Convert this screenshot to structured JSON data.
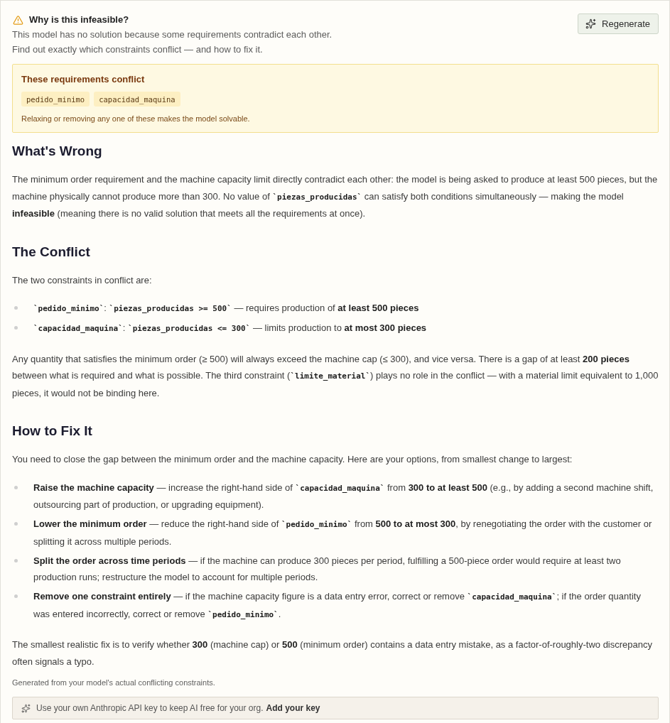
{
  "header": {
    "title": "Why is this infeasible?",
    "description": [
      "This model has no solution because some requirements contradict each other.",
      "Find out exactly which constraints conflict — and how to fix it."
    ],
    "regenerate_button": "Regenerate"
  },
  "conflict_box": {
    "title": "These requirements conflict",
    "constraints": [
      "pedido_minimo",
      "capacidad_maquina"
    ],
    "note": "Relaxing or removing any one of these makes the model solvable."
  },
  "sections": [
    {
      "heading": "What's Wrong",
      "blocks": [
        {
          "kind": "paragraph",
          "segments": [
            {
              "kind": "text",
              "text": "The minimum order requirement and the machine capacity limit directly contradict each other: the model is being asked to produce at least 500 pieces, but the machine physically cannot produce more than 300. No value of "
            },
            {
              "kind": "code",
              "text": "`piezas_producidas`"
            },
            {
              "kind": "text",
              "text": " can satisfy both conditions simultaneously — making the model "
            },
            {
              "kind": "bold",
              "text": "infeasible"
            },
            {
              "kind": "text",
              "text": " (meaning there is no valid solution that meets all the requirements at once)."
            }
          ]
        }
      ]
    },
    {
      "heading": "The Conflict",
      "blocks": [
        {
          "kind": "paragraph",
          "segments": [
            {
              "kind": "text",
              "text": "The two constraints in conflict are:"
            }
          ]
        },
        {
          "kind": "list",
          "items": [
            {
              "segments": [
                {
                  "kind": "code",
                  "text": "`pedido_minimo`"
                },
                {
                  "kind": "text",
                  "text": ": "
                },
                {
                  "kind": "code",
                  "text": "`piezas_producidas >= 500`"
                },
                {
                  "kind": "text",
                  "text": " — requires production of "
                },
                {
                  "kind": "bold",
                  "text": "at least 500 pieces"
                }
              ]
            },
            {
              "segments": [
                {
                  "kind": "code",
                  "text": "`capacidad_maquina`"
                },
                {
                  "kind": "text",
                  "text": ": "
                },
                {
                  "kind": "code",
                  "text": "`piezas_producidas <= 300`"
                },
                {
                  "kind": "text",
                  "text": " — limits production to "
                },
                {
                  "kind": "bold",
                  "text": "at most 300 pieces"
                }
              ]
            }
          ]
        },
        {
          "kind": "paragraph",
          "segments": [
            {
              "kind": "text",
              "text": "Any quantity that satisfies the minimum order (≥ 500) will always exceed the machine cap (≤ 300), and vice versa. There is a gap of at least "
            },
            {
              "kind": "bold",
              "text": "200 pieces"
            },
            {
              "kind": "text",
              "text": " between what is required and what is possible. The third constraint ("
            },
            {
              "kind": "code",
              "text": "`limite_material`"
            },
            {
              "kind": "text",
              "text": ") plays no role in the conflict — with a material limit equivalent to 1,000 pieces, it would not be binding here."
            }
          ]
        }
      ]
    },
    {
      "heading": "How to Fix It",
      "blocks": [
        {
          "kind": "paragraph",
          "segments": [
            {
              "kind": "text",
              "text": "You need to close the gap between the minimum order and the machine capacity. Here are your options, from smallest change to largest:"
            }
          ]
        },
        {
          "kind": "list",
          "items": [
            {
              "segments": [
                {
                  "kind": "bold",
                  "text": "Raise the machine capacity"
                },
                {
                  "kind": "text",
                  "text": " — increase the right-hand side of "
                },
                {
                  "kind": "code",
                  "text": "`capacidad_maquina`"
                },
                {
                  "kind": "text",
                  "text": " from "
                },
                {
                  "kind": "bold",
                  "text": "300 to at least 500"
                },
                {
                  "kind": "text",
                  "text": " (e.g., by adding a second machine shift, outsourcing part of production, or upgrading equipment)."
                }
              ]
            },
            {
              "segments": [
                {
                  "kind": "bold",
                  "text": "Lower the minimum order"
                },
                {
                  "kind": "text",
                  "text": " — reduce the right-hand side of "
                },
                {
                  "kind": "code",
                  "text": "`pedido_minimo`"
                },
                {
                  "kind": "text",
                  "text": " from "
                },
                {
                  "kind": "bold",
                  "text": "500 to at most 300"
                },
                {
                  "kind": "text",
                  "text": ", by renegotiating the order with the customer or splitting it across multiple periods."
                }
              ]
            },
            {
              "segments": [
                {
                  "kind": "bold",
                  "text": "Split the order across time periods"
                },
                {
                  "kind": "text",
                  "text": " — if the machine can produce 300 pieces per period, fulfilling a 500-piece order would require at least two production runs; restructure the model to account for multiple periods."
                }
              ]
            },
            {
              "segments": [
                {
                  "kind": "bold",
                  "text": "Remove one constraint entirely"
                },
                {
                  "kind": "text",
                  "text": " — if the machine capacity figure is a data entry error, correct or remove "
                },
                {
                  "kind": "code",
                  "text": "`capacidad_maquina`"
                },
                {
                  "kind": "text",
                  "text": "; if the order quantity was entered incorrectly, correct or remove "
                },
                {
                  "kind": "code",
                  "text": "`pedido_minimo`"
                },
                {
                  "kind": "text",
                  "text": "."
                }
              ]
            }
          ]
        },
        {
          "kind": "paragraph",
          "segments": [
            {
              "kind": "text",
              "text": "The smallest realistic fix is to verify whether "
            },
            {
              "kind": "bold",
              "text": "300"
            },
            {
              "kind": "text",
              "text": " (machine cap) or "
            },
            {
              "kind": "bold",
              "text": "500"
            },
            {
              "kind": "text",
              "text": " (minimum order) contains a data entry mistake, as a factor-of-roughly-two discrepancy often signals a typo."
            }
          ]
        }
      ]
    }
  ],
  "footer_note": "Generated from your model's actual conflicting constraints.",
  "api_key_banner": {
    "text": "Use your own Anthropic API key to keep AI free for your org.",
    "link": "Add your key"
  }
}
